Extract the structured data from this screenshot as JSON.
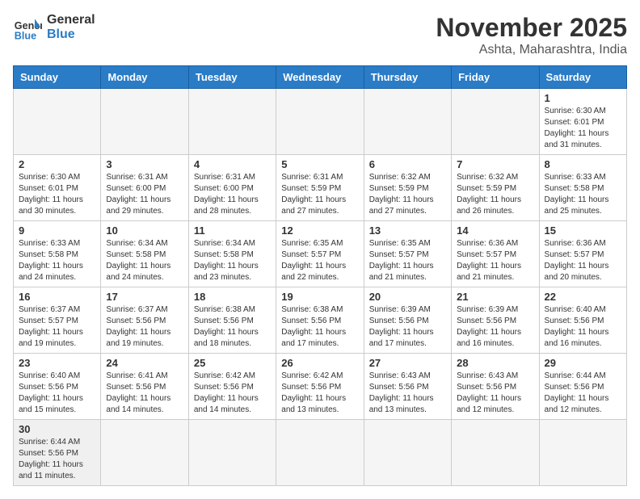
{
  "header": {
    "logo_general": "General",
    "logo_blue": "Blue",
    "month_title": "November 2025",
    "location": "Ashta, Maharashtra, India"
  },
  "weekdays": [
    "Sunday",
    "Monday",
    "Tuesday",
    "Wednesday",
    "Thursday",
    "Friday",
    "Saturday"
  ],
  "weeks": [
    [
      {
        "day": "",
        "info": ""
      },
      {
        "day": "",
        "info": ""
      },
      {
        "day": "",
        "info": ""
      },
      {
        "day": "",
        "info": ""
      },
      {
        "day": "",
        "info": ""
      },
      {
        "day": "",
        "info": ""
      },
      {
        "day": "1",
        "info": "Sunrise: 6:30 AM\nSunset: 6:01 PM\nDaylight: 11 hours\nand 31 minutes."
      }
    ],
    [
      {
        "day": "2",
        "info": "Sunrise: 6:30 AM\nSunset: 6:01 PM\nDaylight: 11 hours\nand 30 minutes."
      },
      {
        "day": "3",
        "info": "Sunrise: 6:31 AM\nSunset: 6:00 PM\nDaylight: 11 hours\nand 29 minutes."
      },
      {
        "day": "4",
        "info": "Sunrise: 6:31 AM\nSunset: 6:00 PM\nDaylight: 11 hours\nand 28 minutes."
      },
      {
        "day": "5",
        "info": "Sunrise: 6:31 AM\nSunset: 5:59 PM\nDaylight: 11 hours\nand 27 minutes."
      },
      {
        "day": "6",
        "info": "Sunrise: 6:32 AM\nSunset: 5:59 PM\nDaylight: 11 hours\nand 27 minutes."
      },
      {
        "day": "7",
        "info": "Sunrise: 6:32 AM\nSunset: 5:59 PM\nDaylight: 11 hours\nand 26 minutes."
      },
      {
        "day": "8",
        "info": "Sunrise: 6:33 AM\nSunset: 5:58 PM\nDaylight: 11 hours\nand 25 minutes."
      }
    ],
    [
      {
        "day": "9",
        "info": "Sunrise: 6:33 AM\nSunset: 5:58 PM\nDaylight: 11 hours\nand 24 minutes."
      },
      {
        "day": "10",
        "info": "Sunrise: 6:34 AM\nSunset: 5:58 PM\nDaylight: 11 hours\nand 24 minutes."
      },
      {
        "day": "11",
        "info": "Sunrise: 6:34 AM\nSunset: 5:58 PM\nDaylight: 11 hours\nand 23 minutes."
      },
      {
        "day": "12",
        "info": "Sunrise: 6:35 AM\nSunset: 5:57 PM\nDaylight: 11 hours\nand 22 minutes."
      },
      {
        "day": "13",
        "info": "Sunrise: 6:35 AM\nSunset: 5:57 PM\nDaylight: 11 hours\nand 21 minutes."
      },
      {
        "day": "14",
        "info": "Sunrise: 6:36 AM\nSunset: 5:57 PM\nDaylight: 11 hours\nand 21 minutes."
      },
      {
        "day": "15",
        "info": "Sunrise: 6:36 AM\nSunset: 5:57 PM\nDaylight: 11 hours\nand 20 minutes."
      }
    ],
    [
      {
        "day": "16",
        "info": "Sunrise: 6:37 AM\nSunset: 5:57 PM\nDaylight: 11 hours\nand 19 minutes."
      },
      {
        "day": "17",
        "info": "Sunrise: 6:37 AM\nSunset: 5:56 PM\nDaylight: 11 hours\nand 19 minutes."
      },
      {
        "day": "18",
        "info": "Sunrise: 6:38 AM\nSunset: 5:56 PM\nDaylight: 11 hours\nand 18 minutes."
      },
      {
        "day": "19",
        "info": "Sunrise: 6:38 AM\nSunset: 5:56 PM\nDaylight: 11 hours\nand 17 minutes."
      },
      {
        "day": "20",
        "info": "Sunrise: 6:39 AM\nSunset: 5:56 PM\nDaylight: 11 hours\nand 17 minutes."
      },
      {
        "day": "21",
        "info": "Sunrise: 6:39 AM\nSunset: 5:56 PM\nDaylight: 11 hours\nand 16 minutes."
      },
      {
        "day": "22",
        "info": "Sunrise: 6:40 AM\nSunset: 5:56 PM\nDaylight: 11 hours\nand 16 minutes."
      }
    ],
    [
      {
        "day": "23",
        "info": "Sunrise: 6:40 AM\nSunset: 5:56 PM\nDaylight: 11 hours\nand 15 minutes."
      },
      {
        "day": "24",
        "info": "Sunrise: 6:41 AM\nSunset: 5:56 PM\nDaylight: 11 hours\nand 14 minutes."
      },
      {
        "day": "25",
        "info": "Sunrise: 6:42 AM\nSunset: 5:56 PM\nDaylight: 11 hours\nand 14 minutes."
      },
      {
        "day": "26",
        "info": "Sunrise: 6:42 AM\nSunset: 5:56 PM\nDaylight: 11 hours\nand 13 minutes."
      },
      {
        "day": "27",
        "info": "Sunrise: 6:43 AM\nSunset: 5:56 PM\nDaylight: 11 hours\nand 13 minutes."
      },
      {
        "day": "28",
        "info": "Sunrise: 6:43 AM\nSunset: 5:56 PM\nDaylight: 11 hours\nand 12 minutes."
      },
      {
        "day": "29",
        "info": "Sunrise: 6:44 AM\nSunset: 5:56 PM\nDaylight: 11 hours\nand 12 minutes."
      }
    ],
    [
      {
        "day": "30",
        "info": "Sunrise: 6:44 AM\nSunset: 5:56 PM\nDaylight: 11 hours\nand 11 minutes."
      },
      {
        "day": "",
        "info": ""
      },
      {
        "day": "",
        "info": ""
      },
      {
        "day": "",
        "info": ""
      },
      {
        "day": "",
        "info": ""
      },
      {
        "day": "",
        "info": ""
      },
      {
        "day": "",
        "info": ""
      }
    ]
  ]
}
